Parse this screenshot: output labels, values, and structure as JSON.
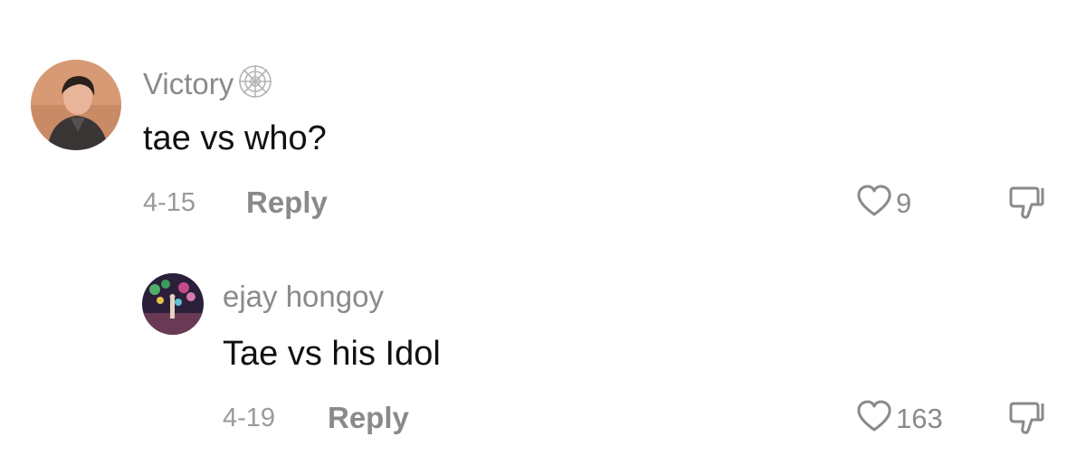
{
  "comments": [
    {
      "username": "Victory",
      "badge_icon": "spider-web-icon",
      "text": "tae vs who?",
      "date": "4-15",
      "reply_label": "Reply",
      "like_count": "9"
    },
    {
      "username": "ejay hongoy",
      "text": "Tae vs his Idol",
      "date": "4-19",
      "reply_label": "Reply",
      "like_count": "163"
    }
  ],
  "colors": {
    "text": "#111111",
    "muted": "#8a8a8a",
    "icon": "#8a8a8a"
  }
}
